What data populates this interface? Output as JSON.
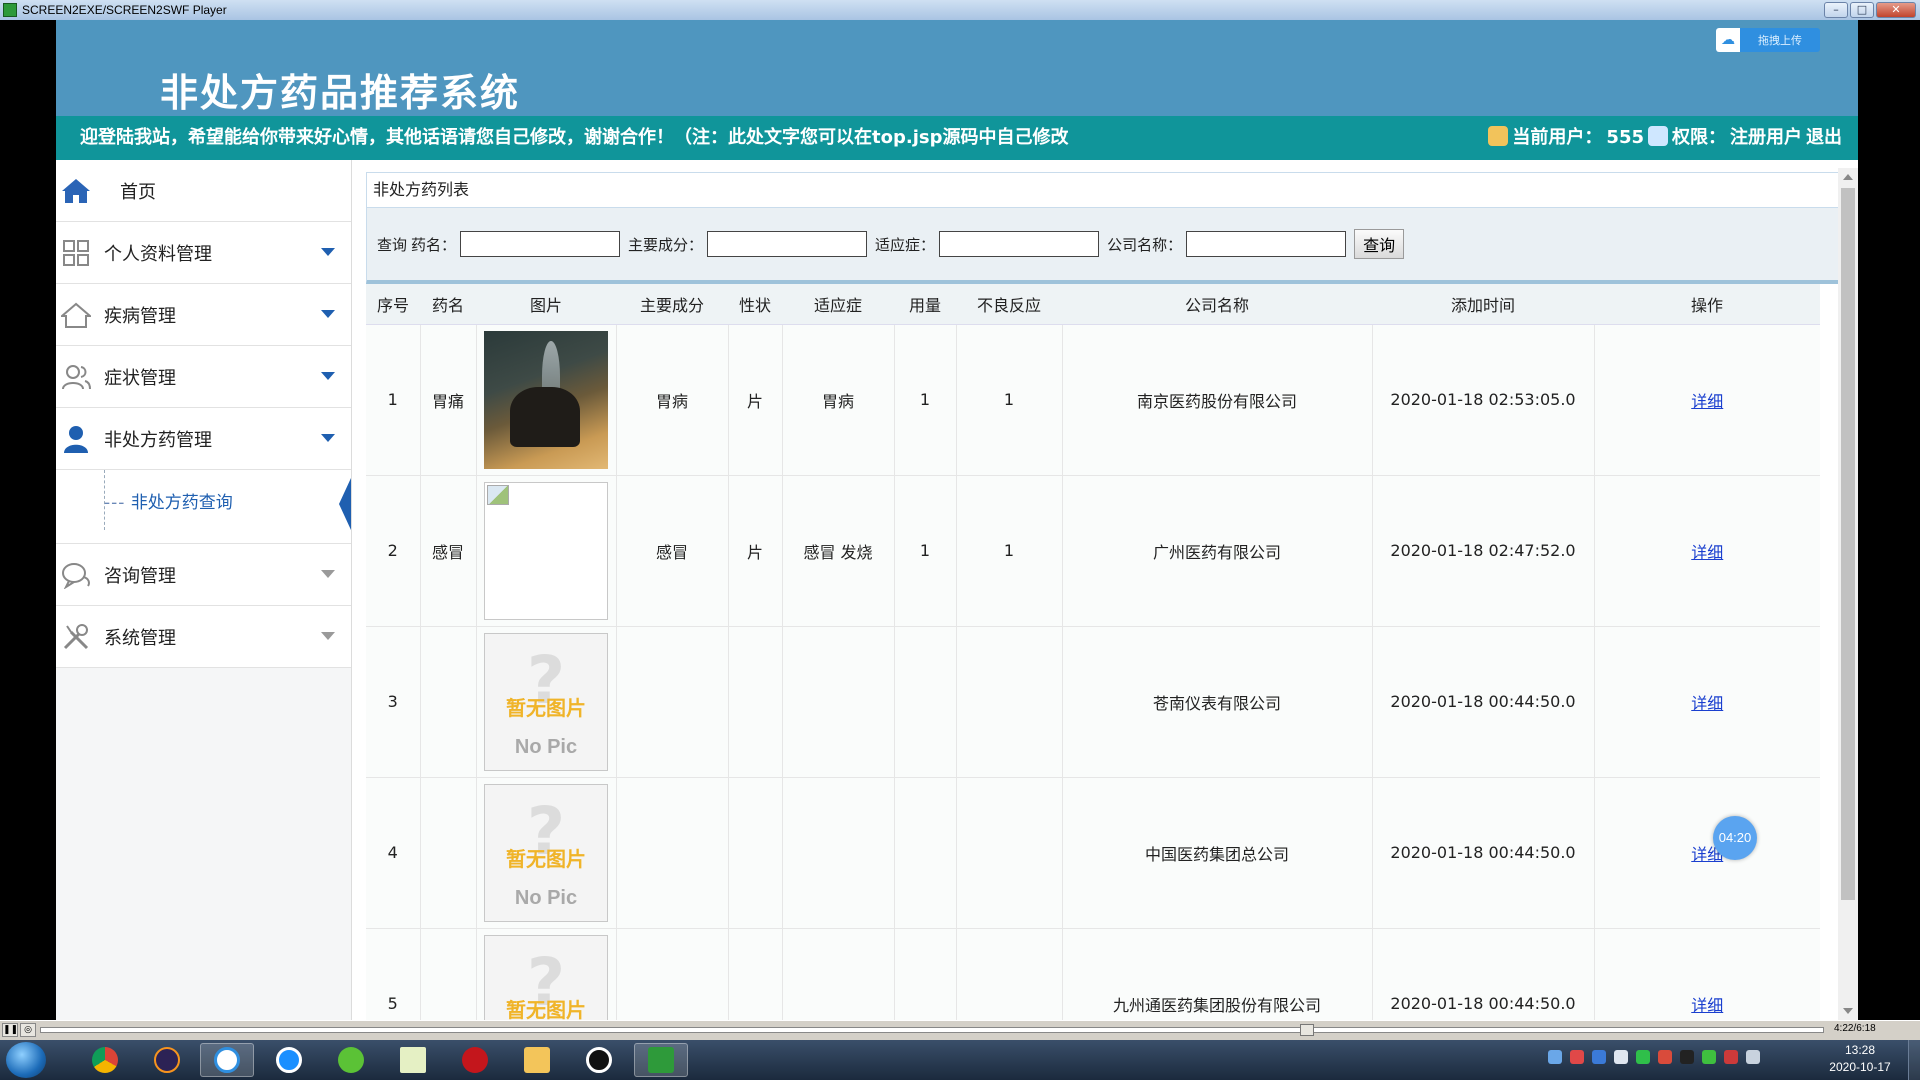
{
  "player": {
    "title": "SCREEN2EXE/SCREEN2SWF Player",
    "time": "4:22/6:18",
    "progress": 0.71
  },
  "header": {
    "title": "非处方药品推荐系统",
    "upload_label": "拖拽上传"
  },
  "notice": {
    "marquee": "迎登陆我站，希望能给你带来好心情，其他话语请您自己修改，谢谢合作！（注：此处文字您可以在top.jsp源码中自己修改",
    "current_user_label": "当前用户：",
    "current_user": "555",
    "role_label": "权限：",
    "role": "注册用户",
    "logout": "退出"
  },
  "sidebar": {
    "home": "首页",
    "items": [
      {
        "label": "个人资料管理",
        "icon": "grid-icon"
      },
      {
        "label": "疾病管理",
        "icon": "house-icon"
      },
      {
        "label": "症状管理",
        "icon": "users-icon"
      },
      {
        "label": "非处方药管理",
        "icon": "person-icon"
      },
      {
        "label": "咨询管理",
        "icon": "chat-icon"
      },
      {
        "label": "系统管理",
        "icon": "tools-icon"
      }
    ],
    "submenu": {
      "dash": "---",
      "label": "非处方药查询"
    }
  },
  "panel": {
    "title": "非处方药列表"
  },
  "search": {
    "prefix": "查询",
    "name_label": "药名：",
    "ingredient_label": "主要成分：",
    "indication_label": "适应症：",
    "company_label": "公司名称：",
    "name_value": "",
    "ingredient_value": "",
    "indication_value": "",
    "company_value": "",
    "button": "查询"
  },
  "table": {
    "headers": [
      "序号",
      "药名",
      "图片",
      "主要成分",
      "性状",
      "适应症",
      "用量",
      "不良反应",
      "公司名称",
      "添加时间",
      "操作"
    ],
    "rows": [
      {
        "no": "1",
        "name": "胃痛",
        "pic": "photo",
        "ingredient": "胃病",
        "form": "片",
        "indication": "胃病",
        "dose": "1",
        "adverse": "1",
        "company": "南京医药股份有限公司",
        "time": "2020-01-18 02:53:05.0",
        "action": "详细"
      },
      {
        "no": "2",
        "name": "感冒",
        "pic": "broken",
        "ingredient": "感冒",
        "form": "片",
        "indication": "感冒 发烧",
        "dose": "1",
        "adverse": "1",
        "company": "广州医药有限公司",
        "time": "2020-01-18 02:47:52.0",
        "action": "详细"
      },
      {
        "no": "3",
        "name": "",
        "pic": "nopic",
        "ingredient": "",
        "form": "",
        "indication": "",
        "dose": "",
        "adverse": "",
        "company": "苍南仪表有限公司",
        "time": "2020-01-18 00:44:50.0",
        "action": "详细"
      },
      {
        "no": "4",
        "name": "",
        "pic": "nopic",
        "ingredient": "",
        "form": "",
        "indication": "",
        "dose": "",
        "adverse": "",
        "company": "中国医药集团总公司",
        "time": "2020-01-18 00:44:50.0",
        "action": "详细"
      },
      {
        "no": "5",
        "name": "",
        "pic": "nopic",
        "ingredient": "",
        "form": "",
        "indication": "",
        "dose": "",
        "adverse": "",
        "company": "九州通医药集团股份有限公司",
        "time": "2020-01-18 00:44:50.0",
        "action": "详细"
      }
    ],
    "nopic_zh": "暂无图片",
    "nopic_en": "No Pic"
  },
  "timer": "04:20",
  "taskbar": {
    "time": "13:28",
    "date": "2020-10-17"
  },
  "colors": {
    "header_blue": "#4f96bf",
    "notice_teal": "#10959a",
    "link_blue": "#1a3fcf",
    "menu_active": "#1f5fb0"
  }
}
